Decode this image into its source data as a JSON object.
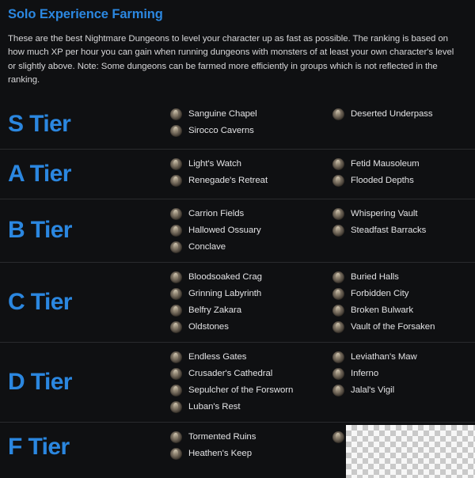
{
  "page": {
    "title": "Solo Experience Farming",
    "intro": "These are the best Nightmare Dungeons to level your character up as fast as possible. The ranking is based on how much XP per hour you can gain when running dungeons with monsters of at least your own character's level or slightly above. Note: Some dungeons can be farmed more efficiently in groups which is not reflected in the ranking.",
    "accent_color": "#2b87e0",
    "background_color": "#0f1012",
    "text_color": "#e2e2e4",
    "divider_color": "#2a2b2e"
  },
  "tiers": [
    {
      "label": "S Tier",
      "col1": [
        {
          "name": "Sanguine Chapel",
          "icon": "dungeon-icon"
        },
        {
          "name": "Sirocco Caverns",
          "icon": "dungeon-icon"
        }
      ],
      "col2": [
        {
          "name": "Deserted Underpass",
          "icon": "dungeon-icon"
        }
      ]
    },
    {
      "label": "A Tier",
      "col1": [
        {
          "name": "Light's Watch",
          "icon": "dungeon-icon"
        },
        {
          "name": "Renegade's Retreat",
          "icon": "dungeon-icon"
        }
      ],
      "col2": [
        {
          "name": "Fetid Mausoleum",
          "icon": "dungeon-icon"
        },
        {
          "name": "Flooded Depths",
          "icon": "dungeon-icon"
        }
      ]
    },
    {
      "label": "B Tier",
      "col1": [
        {
          "name": "Carrion Fields",
          "icon": "dungeon-icon"
        },
        {
          "name": "Hallowed Ossuary",
          "icon": "dungeon-icon"
        },
        {
          "name": "Conclave",
          "icon": "dungeon-icon"
        }
      ],
      "col2": [
        {
          "name": "Whispering Vault",
          "icon": "dungeon-icon"
        },
        {
          "name": "Steadfast Barracks",
          "icon": "dungeon-icon"
        }
      ]
    },
    {
      "label": "C Tier",
      "col1": [
        {
          "name": "Bloodsoaked Crag",
          "icon": "dungeon-icon"
        },
        {
          "name": "Grinning Labyrinth",
          "icon": "dungeon-icon"
        },
        {
          "name": "Belfry Zakara",
          "icon": "dungeon-icon"
        },
        {
          "name": "Oldstones",
          "icon": "dungeon-icon"
        }
      ],
      "col2": [
        {
          "name": "Buried Halls",
          "icon": "dungeon-icon"
        },
        {
          "name": "Forbidden City",
          "icon": "dungeon-icon"
        },
        {
          "name": "Broken Bulwark",
          "icon": "dungeon-icon"
        },
        {
          "name": "Vault of the Forsaken",
          "icon": "dungeon-icon"
        }
      ]
    },
    {
      "label": "D Tier",
      "col1": [
        {
          "name": "Endless Gates",
          "icon": "dungeon-icon"
        },
        {
          "name": "Crusader's Cathedral",
          "icon": "dungeon-icon"
        },
        {
          "name": "Sepulcher of the Forsworn",
          "icon": "dungeon-icon"
        },
        {
          "name": "Luban's Rest",
          "icon": "dungeon-icon"
        }
      ],
      "col2": [
        {
          "name": "Leviathan's Maw",
          "icon": "dungeon-icon"
        },
        {
          "name": "Inferno",
          "icon": "dungeon-icon"
        },
        {
          "name": "Jalal's Vigil",
          "icon": "dungeon-icon"
        }
      ]
    },
    {
      "label": "F Tier",
      "col1": [
        {
          "name": "Tormented Ruins",
          "icon": "dungeon-icon"
        },
        {
          "name": "Heathen's Keep",
          "icon": "dungeon-icon"
        }
      ],
      "col2": [
        {
          "name": "",
          "icon": "dungeon-icon"
        }
      ]
    }
  ],
  "overlay": {
    "type": "transparency-checkerboard"
  }
}
